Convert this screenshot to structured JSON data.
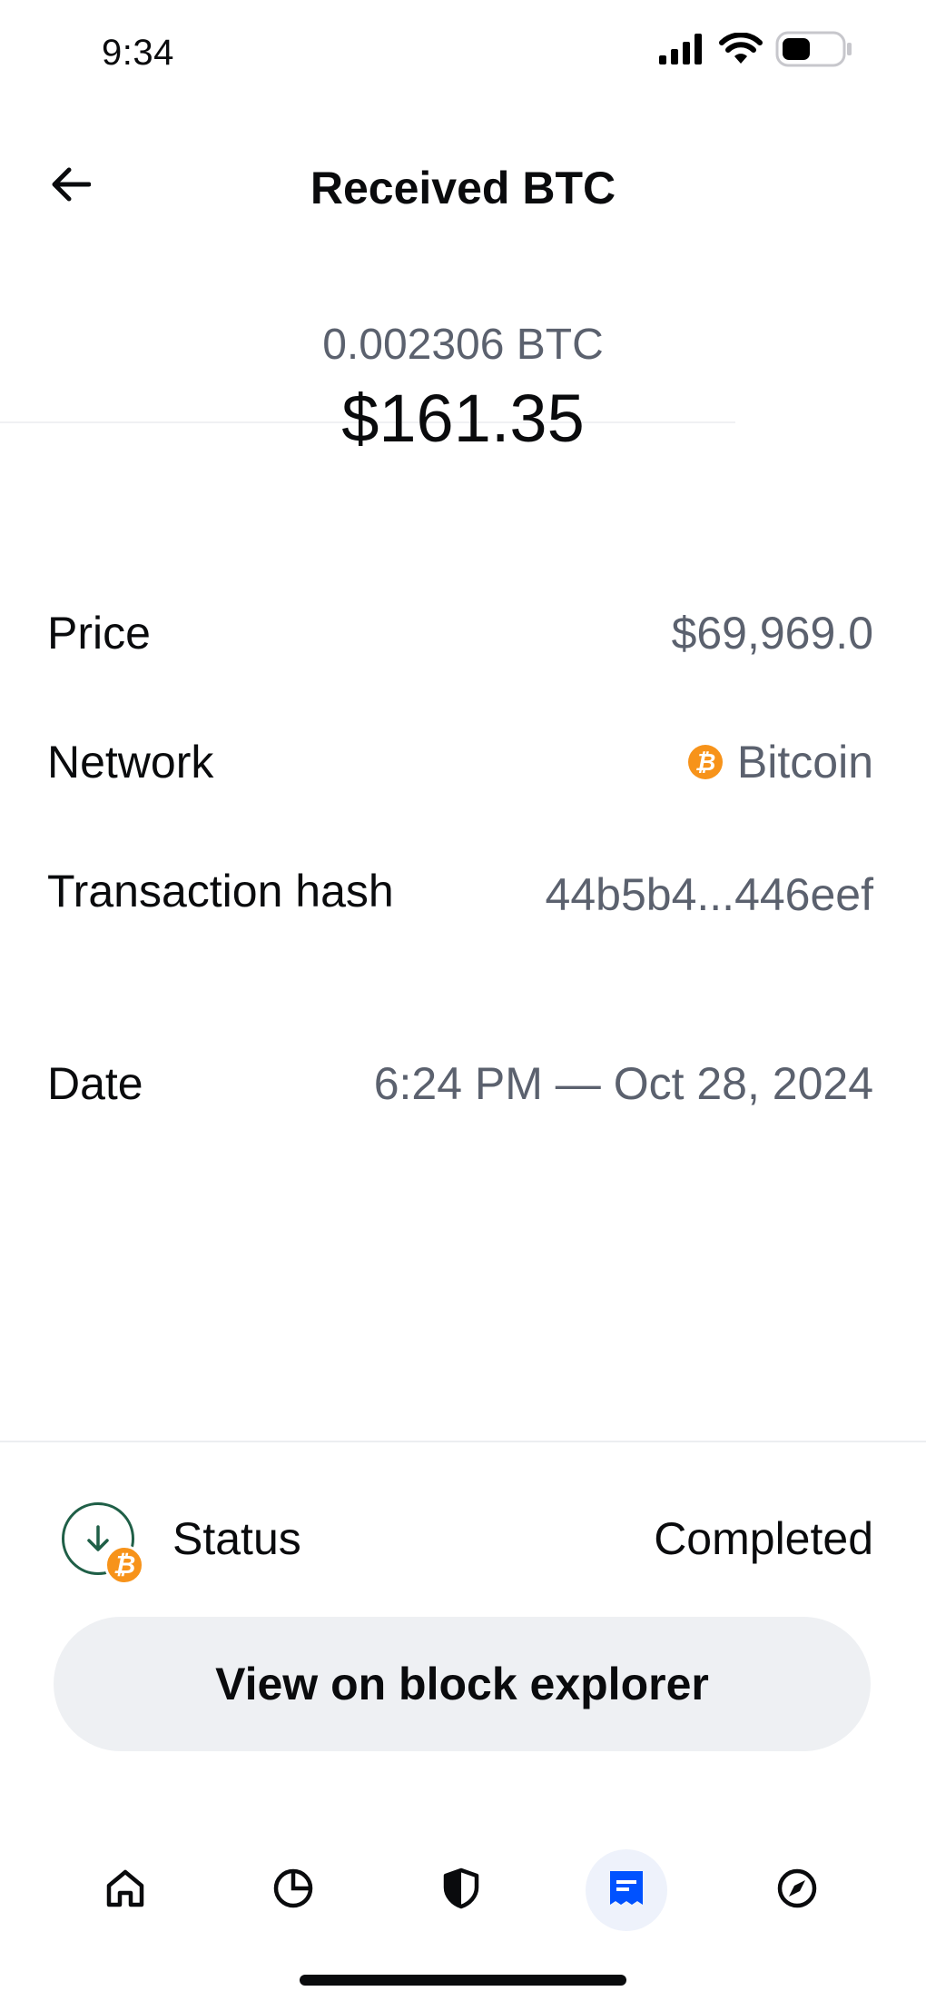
{
  "status_bar": {
    "time": "9:34",
    "icons": [
      "signal-icon",
      "wifi-icon",
      "battery-icon"
    ]
  },
  "header": {
    "back_icon": "back-arrow-icon",
    "title": "Received BTC"
  },
  "amount": {
    "crypto": "0.002306 BTC",
    "fiat": "$161.35"
  },
  "details": {
    "price": {
      "label": "Price",
      "value": "$69,969.0"
    },
    "network": {
      "label": "Network",
      "value": "Bitcoin",
      "icon": "bitcoin-icon"
    },
    "hash": {
      "label": "Transaction hash",
      "value": "44b5b4...446eef"
    },
    "date": {
      "label": "Date",
      "value": "6:24 PM — Oct 28, 2024"
    }
  },
  "status": {
    "label": "Status",
    "value": "Completed",
    "icon": "receive-arrow-icon"
  },
  "explorer_button": {
    "label": "View on block explorer"
  },
  "bottom_nav": {
    "items": [
      {
        "name": "home",
        "icon": "home-icon"
      },
      {
        "name": "portfolio",
        "icon": "pie-chart-icon"
      },
      {
        "name": "security",
        "icon": "shield-icon"
      },
      {
        "name": "transactions",
        "icon": "receipt-icon",
        "active": true
      },
      {
        "name": "explore",
        "icon": "compass-icon"
      }
    ]
  },
  "colors": {
    "accent": "#0052ff",
    "bitcoin": "#f7931a",
    "status_green": "#1f5f47",
    "secondary_text": "#5b616e"
  }
}
